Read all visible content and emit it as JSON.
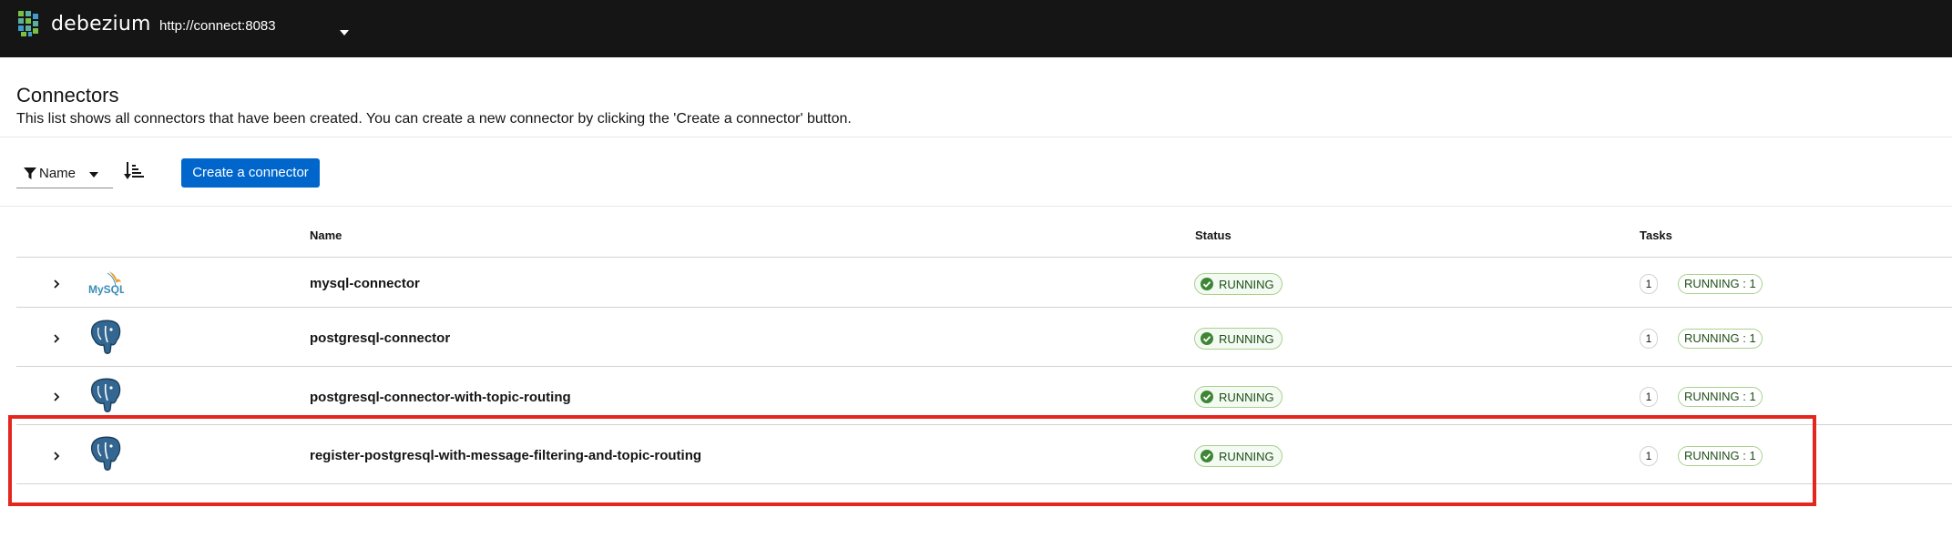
{
  "masthead": {
    "brand": "debezium",
    "cluster_url": "http://connect:8083"
  },
  "page": {
    "title": "Connectors",
    "description": "This list shows all connectors that have been created. You can create a new connector by clicking the 'Create a connector' button."
  },
  "toolbar": {
    "filter_label": "Name",
    "create_label": "Create a connector"
  },
  "table": {
    "columns": [
      "Name",
      "Status",
      "Tasks"
    ],
    "rows": [
      {
        "icon": "mysql",
        "name": "mysql-connector",
        "status": "RUNNING",
        "task_count": "1",
        "task_status": "RUNNING : 1"
      },
      {
        "icon": "postgresql",
        "name": "postgresql-connector",
        "status": "RUNNING",
        "task_count": "1",
        "task_status": "RUNNING : 1"
      },
      {
        "icon": "postgresql",
        "name": "postgresql-connector-with-topic-routing",
        "status": "RUNNING",
        "task_count": "1",
        "task_status": "RUNNING : 1"
      },
      {
        "icon": "postgresql",
        "name": "register-postgresql-with-message-filtering-and-topic-routing",
        "status": "RUNNING",
        "task_count": "1",
        "task_status": "RUNNING : 1"
      }
    ]
  },
  "colors": {
    "masthead": "#151515",
    "primary": "#0066cc",
    "success": "#3e8635",
    "highlight": "#e5261f"
  },
  "mysql_logo_text": "MySQL"
}
